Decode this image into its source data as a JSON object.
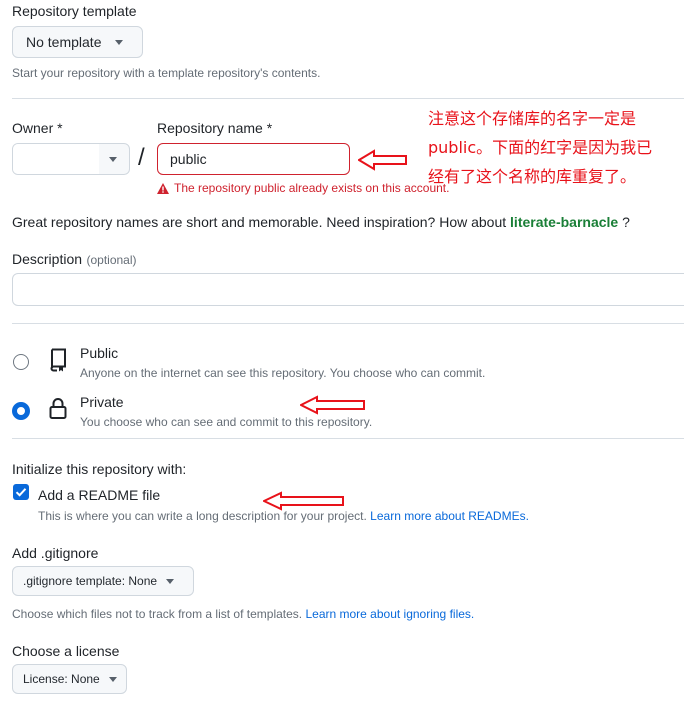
{
  "template": {
    "heading": "Repository template",
    "button_label": "No template",
    "hint": "Start your repository with a template repository's contents."
  },
  "owner": {
    "label": "Owner *",
    "separator": "/"
  },
  "repo_name": {
    "label": "Repository name *",
    "value": "public",
    "error": "The repository public already exists on this account."
  },
  "annotations": {
    "note_line1": "注意这个存储库的名字一定是",
    "note_line2": "public。下面的红字是因为我已",
    "note_line3": "经有了这个名称的库重复了。"
  },
  "suggestion": {
    "text": "Great repository names are short and memorable. Need inspiration? How about",
    "name": "literate-barnacle",
    "suffix": " ?"
  },
  "description": {
    "label": "Description",
    "optional": "(optional)",
    "value": ""
  },
  "visibility": {
    "public_title": "Public",
    "public_desc": "Anyone on the internet can see this repository. You choose who can commit.",
    "private_title": "Private",
    "private_desc": "You choose who can see and commit to this repository.",
    "selected": "private"
  },
  "initialize": {
    "heading": "Initialize this repository with:",
    "readme_label": "Add a README file",
    "readme_checked": true,
    "readme_desc": "This is where you can write a long description for your project.",
    "readme_link": "Learn more about READMEs."
  },
  "gitignore": {
    "heading": "Add .gitignore",
    "button_label": ".gitignore template: None",
    "hint": "Choose which files not to track from a list of templates.",
    "link": "Learn more about ignoring files."
  },
  "license": {
    "heading": "Choose a license",
    "button_label": "License: None"
  },
  "colors": {
    "accent": "#0969da",
    "danger": "#cf222e",
    "annotation_red": "#e8121a",
    "link_green": "#1a7f37"
  }
}
